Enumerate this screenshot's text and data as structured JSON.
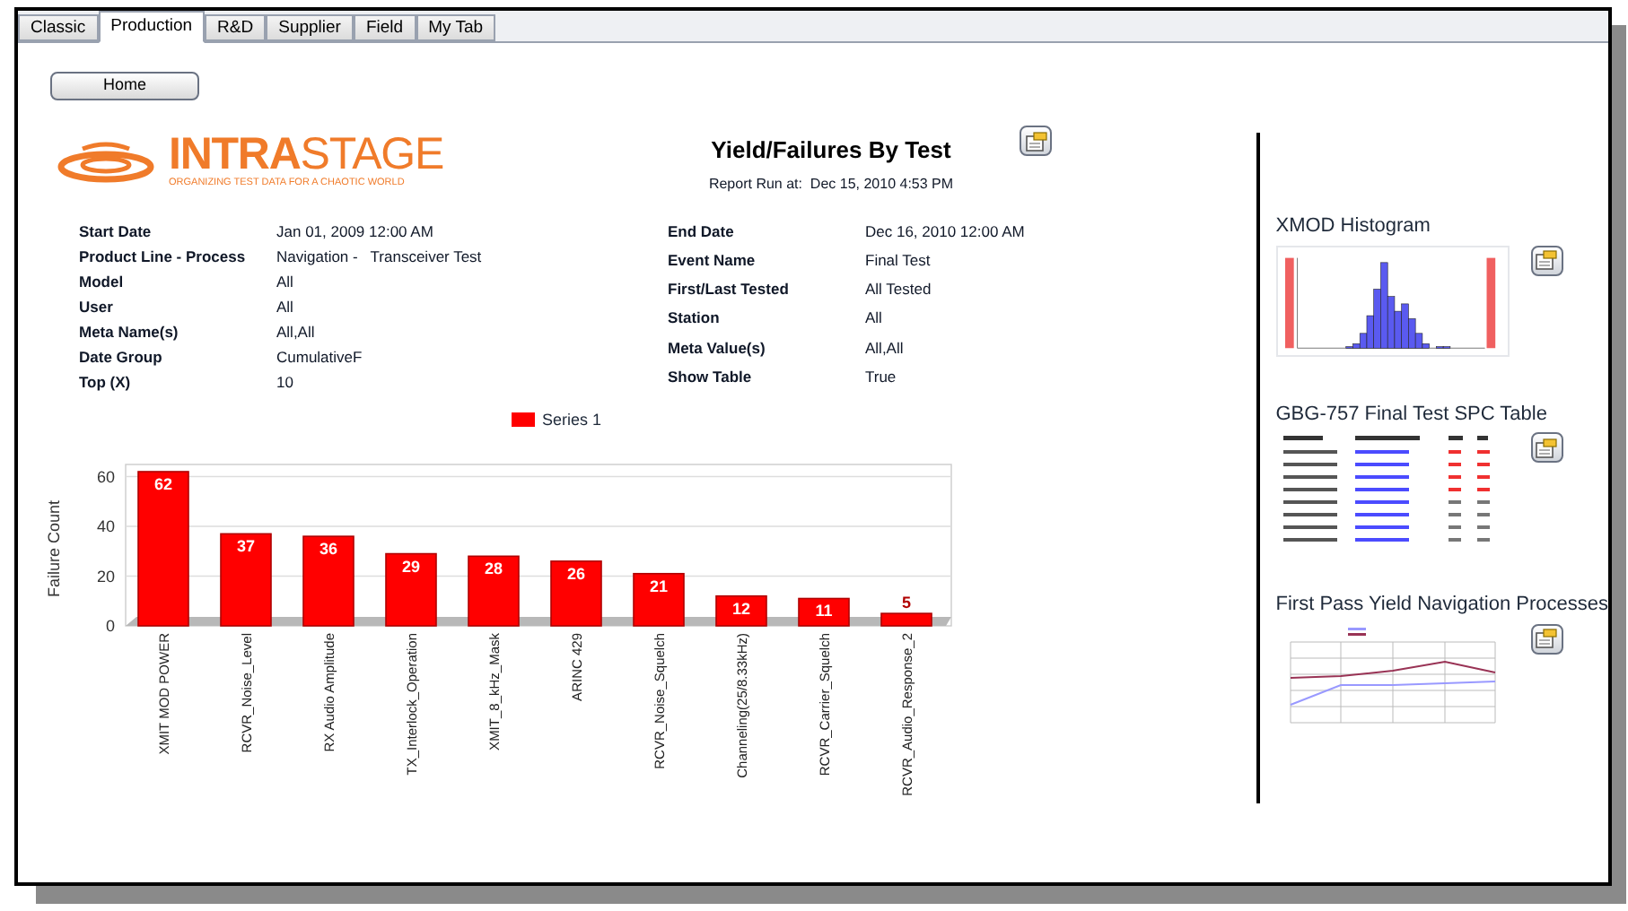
{
  "tabs": [
    {
      "label": "Classic",
      "selected": false
    },
    {
      "label": "Production",
      "selected": true
    },
    {
      "label": "R&D",
      "selected": false
    },
    {
      "label": "Supplier",
      "selected": false
    },
    {
      "label": "Field",
      "selected": false
    },
    {
      "label": "My Tab",
      "selected": false
    }
  ],
  "home_button": "Home",
  "logo": {
    "name": "**INTRA**STAGE",
    "tagline": "ORGANIZING TEST DATA FOR A CHAOTIC WORLD"
  },
  "report": {
    "title": "Yield/Failures By Test",
    "run_at": "Report Run at:  Dec 15, 2010 4:53 PM"
  },
  "parameters_left": [
    {
      "label": "Start Date",
      "value": "Jan 01, 2009 12:00 AM"
    },
    {
      "label": "Product Line - Process",
      "value": "Navigation -   Transceiver Test"
    },
    {
      "label": "Model",
      "value": "All"
    },
    {
      "label": "User",
      "value": "All"
    },
    {
      "label": "Meta Name(s)",
      "value": "All,All"
    },
    {
      "label": "Date Group",
      "value": "CumulativeF"
    },
    {
      "label": "Top (X)",
      "value": "10"
    }
  ],
  "parameters_right": [
    {
      "label": "End Date",
      "value": "Dec 16, 2010 12:00 AM"
    },
    {
      "label": "Event Name",
      "value": "Final Test"
    },
    {
      "label": "First/Last Tested",
      "value": "All Tested"
    },
    {
      "label": "Station",
      "value": "All"
    },
    {
      "label": "Meta Value(s)",
      "value": "All,All"
    },
    {
      "label": "Show Table",
      "value": "True"
    }
  ],
  "chart_data": {
    "type": "bar",
    "ylabel": "Failure Count",
    "categories": [
      "XMIT MOD POWER",
      "RCVR_Noise_Level",
      "RX Audio Amplitude",
      "TX_Interlock_Operation",
      "XMIT_8_kHz_Mask",
      "ARINC 429",
      "RCVR_Noise_Squelch",
      "Channeling(25/8.33kHz)",
      "RCVR_Carrier_Squelch",
      "RCVR_Audio_Response_2"
    ],
    "series": [
      {
        "name": "Series 1",
        "color": "#ff0000",
        "values": [
          62,
          37,
          36,
          29,
          28,
          26,
          21,
          12,
          11,
          5
        ]
      }
    ],
    "ylim": [
      0,
      62
    ],
    "yticks": [
      0,
      20,
      40,
      60
    ],
    "grid": true,
    "data_labels": true
  },
  "widgets": [
    {
      "title": "XMOD Histogram",
      "kind": "histogram"
    },
    {
      "title": "GBG-757 Final Test SPC Table",
      "kind": "table"
    },
    {
      "title": "First Pass Yield Navigation Processes",
      "kind": "line"
    }
  ]
}
